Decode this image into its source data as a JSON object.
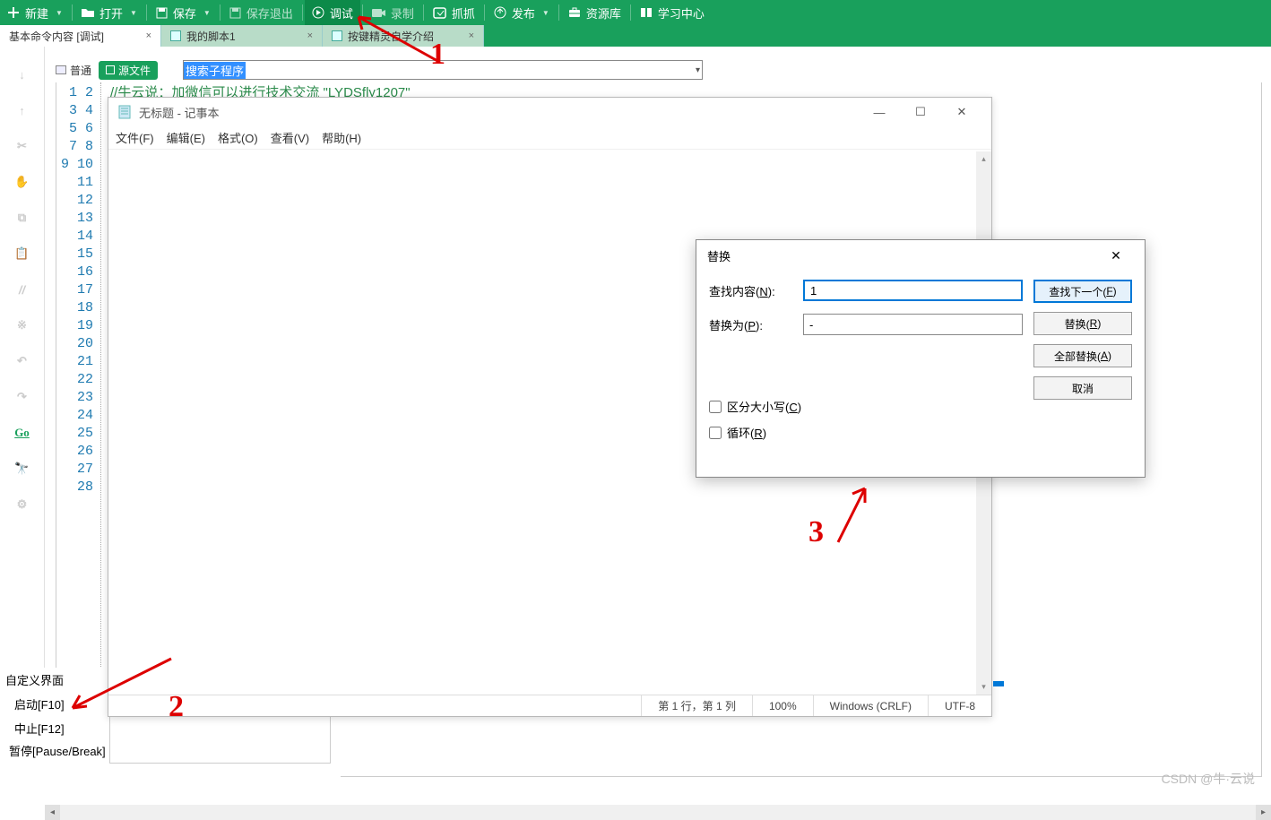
{
  "toolbar": {
    "new": "新建",
    "open": "打开",
    "save": "保存",
    "save_exit": "保存退出",
    "debug": "调试",
    "record": "录制",
    "capture": "抓抓",
    "publish": "发布",
    "resources": "资源库",
    "learn": "学习中心"
  },
  "tabs": [
    {
      "label": "基本命令内容 [调试]"
    },
    {
      "label": "我的脚本1"
    },
    {
      "label": "按键精灵自学介绍"
    }
  ],
  "mode_label": "普通",
  "source_btn": "源文件",
  "search_value": "搜索子程序",
  "code_comment": "//牛云说：加微信可以进行技术交流 \"LYDSfly1207\"",
  "line_count": 28,
  "gutter": {
    "go": "Go"
  },
  "bottom_panel": {
    "header": "自定义界面",
    "start": "启动[F10]",
    "stop": "中止[F12]",
    "pause": "暂停[Pause/Break]"
  },
  "notepad": {
    "title": "无标题 - 记事本",
    "menu": {
      "file": "文件(F)",
      "edit": "编辑(E)",
      "format": "格式(O)",
      "view": "查看(V)",
      "help": "帮助(H)"
    },
    "status": {
      "pos": "第 1 行，第 1 列",
      "zoom": "100%",
      "eol": "Windows (CRLF)",
      "enc": "UTF-8"
    }
  },
  "replace": {
    "title": "替换",
    "find_label": "查找内容(N):",
    "replace_label": "替换为(P):",
    "find_value": "1",
    "replace_value": "-",
    "btn_findnext": "查找下一个(F)",
    "btn_replace": "替换(R)",
    "btn_replaceall": "全部替换(A)",
    "btn_cancel": "取消",
    "chk_case": "区分大小写(C)",
    "chk_wrap": "循环(R)"
  },
  "annotations": {
    "n1": "1",
    "n2": "2",
    "n3": "3"
  },
  "watermark": "CSDN @牛·云说"
}
